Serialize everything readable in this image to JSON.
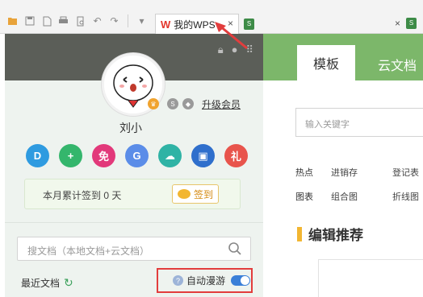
{
  "toolbar": {
    "icons": [
      "open-folder-icon",
      "save-icon",
      "export-pdf-icon",
      "print-icon",
      "print-preview-icon",
      "undo-icon",
      "redo-icon",
      "dropdown-icon"
    ]
  },
  "tabs": {
    "active_label": "我的WPS",
    "close_symbol": "×"
  },
  "header_icons": [
    "lock-icon",
    "chat-icon",
    "grid-icon"
  ],
  "profile": {
    "username": "刘小",
    "upgrade_label": "升级会员",
    "badge_s": "S"
  },
  "apps": [
    {
      "name": "app-d",
      "glyph": "D",
      "color": "#2f9be0"
    },
    {
      "name": "app-plus",
      "glyph": "+",
      "color": "#34b66c"
    },
    {
      "name": "app-free",
      "glyph": "免",
      "color": "#e2397a"
    },
    {
      "name": "app-g",
      "glyph": "G",
      "color": "#5b8de8"
    },
    {
      "name": "app-cloud",
      "glyph": "☁",
      "color": "#2fb3a5"
    },
    {
      "name": "app-doc",
      "glyph": "▣",
      "color": "#2f6fcc"
    },
    {
      "name": "app-gift",
      "glyph": "礼",
      "color": "#e8544c"
    }
  ],
  "signin": {
    "text": "本月累计签到 0 天",
    "button_label": "签到"
  },
  "search": {
    "placeholder": "搜文档（本地文档+云文档）"
  },
  "recent": {
    "label": "最近文档"
  },
  "autoroam": {
    "label": "自动漫游",
    "enabled": true
  },
  "right": {
    "tab_active": "模板",
    "tab_other": "云文档",
    "search_placeholder": "输入关键字",
    "rows": [
      {
        "key": "热点",
        "v1": "进销存",
        "v2": "登记表"
      },
      {
        "key": "图表",
        "v1": "组合图",
        "v2": "折线图"
      }
    ],
    "section_title": "编辑推荐"
  },
  "colors": {
    "left_header": "#5b5e58",
    "right_header": "#7cb76a",
    "highlight_box": "#e23d3d",
    "toggle": "#3a7fd8"
  }
}
